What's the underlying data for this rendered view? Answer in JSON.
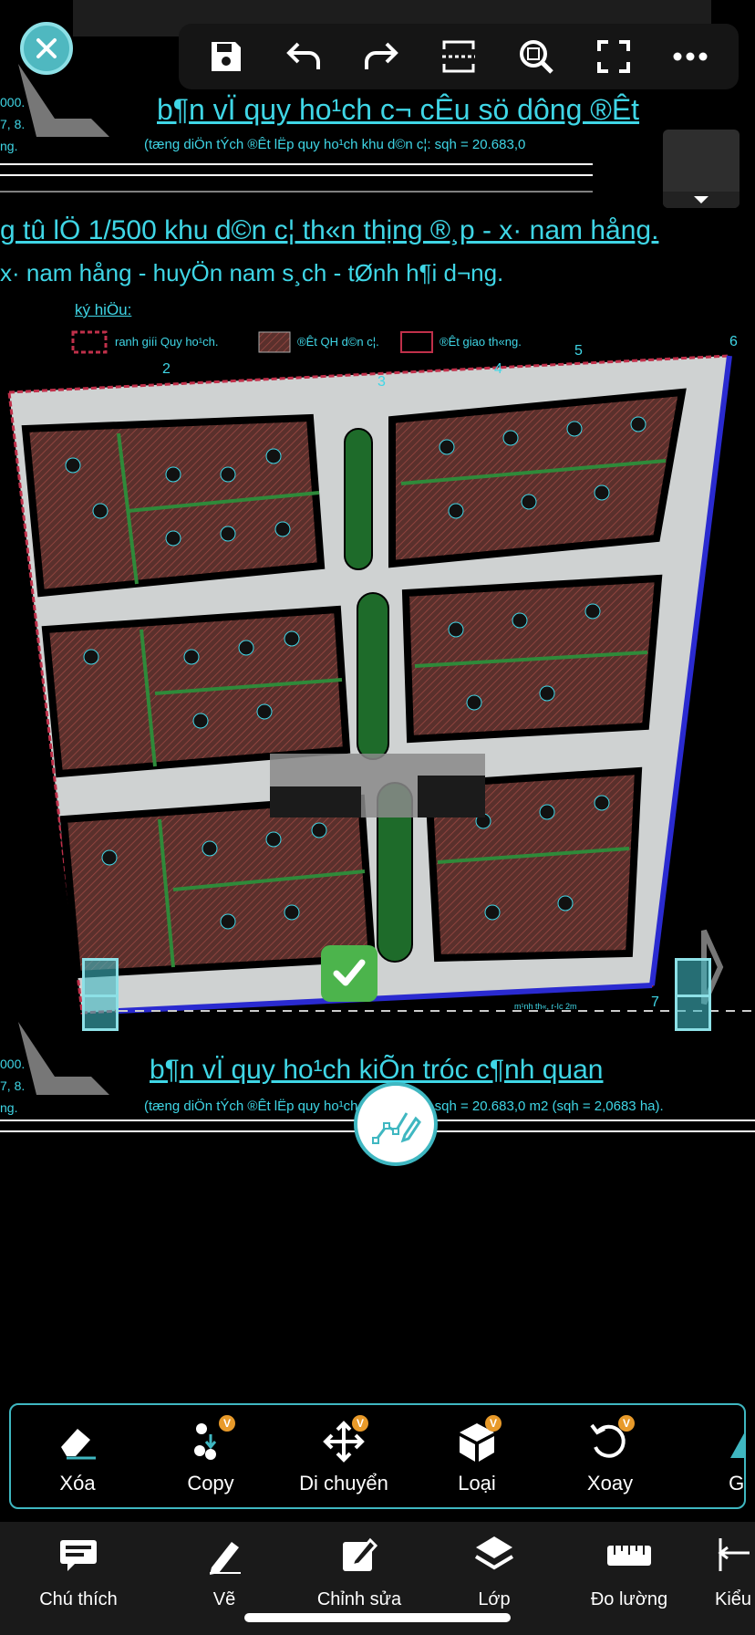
{
  "plan": {
    "title_top": "b¶n vÏ quy ho¹ch c¬ cÊu sö dông ®Êt",
    "subtitle_top": "(tæng diÖn tÝch ®Êt lËp quy ho¹ch khu d©n c¦: sqh = 20.683,0",
    "project_line1": "g tû lÖ 1/500 khu d©n c¦ th«n thịng ®¸p - x· nam hång.",
    "project_line2": "x· nam hång - huyÖn nam s¸ch - tØnh h¶i d¬ng.",
    "legend_title": "ký hiÖu:",
    "legend_items": [
      "ranh giíi Quy ho¹ch.",
      "®Êt QH d©n c¦.",
      "®Êt giao th«ng."
    ],
    "point_labels": [
      "2",
      "3",
      "4",
      "5",
      "6",
      "7"
    ],
    "edge_left": [
      "000.",
      "7, 8.",
      "ng."
    ],
    "edge_left_bottom": [
      "000.",
      "7, 8.",
      "ng."
    ],
    "title_bottom": "b¶n vÏ quy ho¹ch kiÕn tróc c¶nh quan",
    "subtitle_bottom": "(tæng diÖn tÝch ®Êt lËp quy ho¹ch khu d©n c¦: sqh = 20.683,0 m2 (sqh = 2,0683 ha).",
    "road_note": "m¹nh th«, r-Ic 2m"
  },
  "top_toolbar": {
    "icons": [
      "save-icon",
      "undo-icon",
      "redo-icon",
      "scan-icon",
      "zoom-icon",
      "fullscreen-icon",
      "more-icon"
    ]
  },
  "edit_toolbar": {
    "items": [
      {
        "label": "Xóa",
        "icon": "eraser-icon",
        "badge": ""
      },
      {
        "label": "Copy",
        "icon": "copy-icon",
        "badge": "V"
      },
      {
        "label": "Di chuyển",
        "icon": "move-icon",
        "badge": "V"
      },
      {
        "label": "Loại",
        "icon": "cube-icon",
        "badge": "V"
      },
      {
        "label": "Xoay",
        "icon": "rotate-icon",
        "badge": "V"
      },
      {
        "label": "Gư",
        "icon": "mirror-icon",
        "badge": ""
      }
    ]
  },
  "bottom_bar": {
    "items": [
      {
        "label": "Chú thích",
        "icon": "annotation-icon"
      },
      {
        "label": "Vẽ",
        "icon": "pen-icon"
      },
      {
        "label": "Chỉnh sửa",
        "icon": "edit-icon"
      },
      {
        "label": "Lớp",
        "icon": "layers-icon"
      },
      {
        "label": "Đo lường",
        "icon": "ruler-icon"
      },
      {
        "label": "Kiểu",
        "icon": "dimension-icon"
      }
    ]
  },
  "colors": {
    "cad_cyan": "#3fd6e6",
    "accent_teal": "#3fb7c1",
    "lot_brown": "#6b3a34",
    "road_gray": "#cfd2d2",
    "green_strip": "#1e6b2a"
  }
}
